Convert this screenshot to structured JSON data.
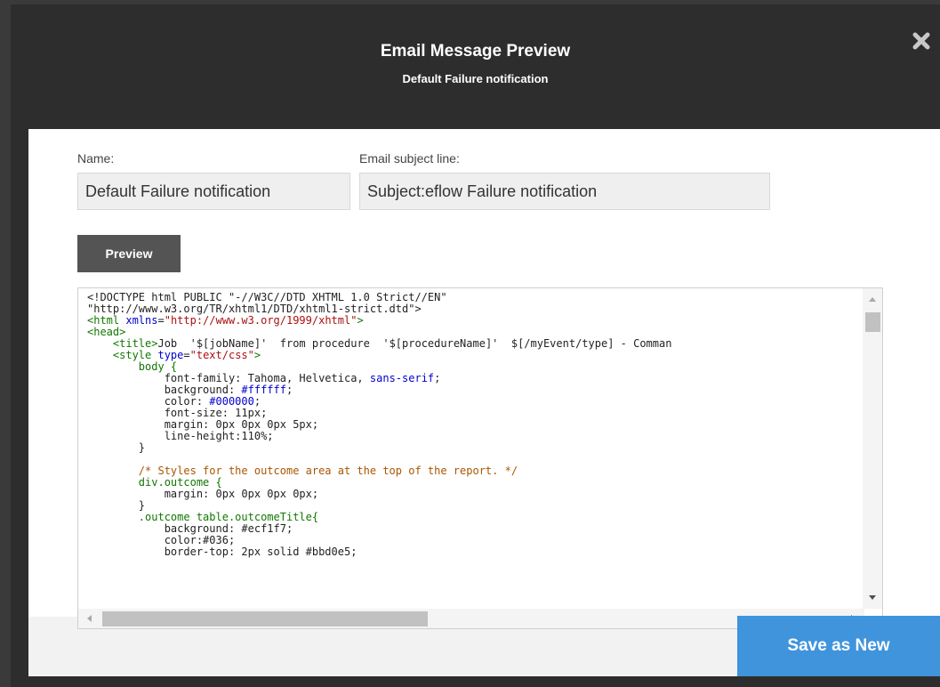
{
  "header": {
    "title": "Email Message Preview",
    "subtitle": "Default Failure notification",
    "close_icon": "close-x-icon"
  },
  "form": {
    "name_label": "Name:",
    "name_value": "Default Failure notification",
    "subject_label": "Email subject line:",
    "subject_value": "Subject:eflow Failure notification"
  },
  "preview_button": "Preview",
  "code": {
    "lines": [
      [
        {
          "t": "<!DOCTYPE html PUBLIC \"-//W3C//DTD XHTML 1.0 Strict//EN\"",
          "c": "#222222"
        }
      ],
      [
        {
          "t": "\"http://www.w3.org/TR/xhtml1/DTD/xhtml1-strict.dtd\">",
          "c": "#222222"
        }
      ],
      [
        {
          "t": "<html ",
          "c": "#117700"
        },
        {
          "t": "xmlns",
          "c": "#0000cc"
        },
        {
          "t": "=",
          "c": "#222222"
        },
        {
          "t": "\"http://www.w3.org/1999/xhtml\"",
          "c": "#aa1111"
        },
        {
          "t": ">",
          "c": "#117700"
        }
      ],
      [
        {
          "t": "<head>",
          "c": "#117700"
        }
      ],
      [
        {
          "t": "    ",
          "c": "#222222"
        },
        {
          "t": "<title>",
          "c": "#117700"
        },
        {
          "t": "Job  '$[jobName]'  from procedure  '$[procedureName]'  $[/myEvent/type] - Comman",
          "c": "#222222"
        }
      ],
      [
        {
          "t": "    ",
          "c": "#222222"
        },
        {
          "t": "<style ",
          "c": "#117700"
        },
        {
          "t": "type",
          "c": "#0000cc"
        },
        {
          "t": "=",
          "c": "#222222"
        },
        {
          "t": "\"text/css\"",
          "c": "#aa1111"
        },
        {
          "t": ">",
          "c": "#117700"
        }
      ],
      [
        {
          "t": "        body {",
          "c": "#117700"
        }
      ],
      [
        {
          "t": "            font-family: Tahoma, Helvetica, ",
          "c": "#222222"
        },
        {
          "t": "sans-serif",
          "c": "#0000cc"
        },
        {
          "t": ";",
          "c": "#222222"
        }
      ],
      [
        {
          "t": "            background: ",
          "c": "#222222"
        },
        {
          "t": "#ffffff",
          "c": "#0000cc"
        },
        {
          "t": ";",
          "c": "#222222"
        }
      ],
      [
        {
          "t": "            color: ",
          "c": "#222222"
        },
        {
          "t": "#000000",
          "c": "#0000cc"
        },
        {
          "t": ";",
          "c": "#222222"
        }
      ],
      [
        {
          "t": "            font-size: 11px;",
          "c": "#222222"
        }
      ],
      [
        {
          "t": "            margin: 0px 0px 0px 5px;",
          "c": "#222222"
        }
      ],
      [
        {
          "t": "            line-height:110%;",
          "c": "#222222"
        }
      ],
      [
        {
          "t": "        }",
          "c": "#222222"
        }
      ],
      [
        {
          "t": "",
          "c": "#222222"
        }
      ],
      [
        {
          "t": "        /* Styles for the outcome area at the top of the report. */",
          "c": "#aa5500"
        }
      ],
      [
        {
          "t": "        div.outcome {",
          "c": "#117700"
        }
      ],
      [
        {
          "t": "            margin: 0px 0px 0px 0px;",
          "c": "#222222"
        }
      ],
      [
        {
          "t": "        }",
          "c": "#222222"
        }
      ],
      [
        {
          "t": "        .outcome table.outcomeTitle{",
          "c": "#117700"
        }
      ],
      [
        {
          "t": "            background: #ecf1f7;",
          "c": "#222222"
        }
      ],
      [
        {
          "t": "            color:#036;",
          "c": "#222222"
        }
      ],
      [
        {
          "t": "            border-top: 2px solid #bbd0e5;",
          "c": "#222222"
        }
      ]
    ]
  },
  "save_button": "Save as New"
}
